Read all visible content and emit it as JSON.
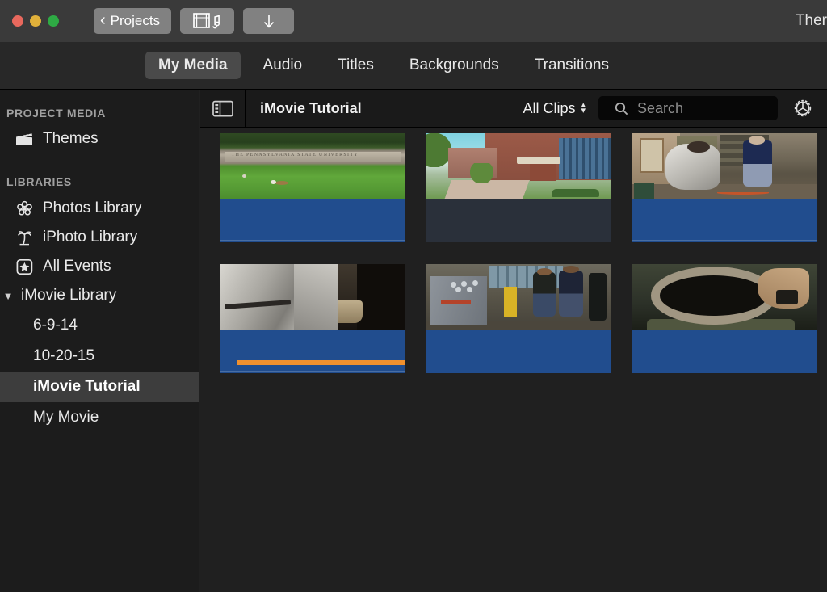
{
  "window": {
    "title": "Ther",
    "traffic_lights": [
      {
        "name": "close",
        "color": "#e8685d"
      },
      {
        "name": "minimize",
        "color": "#e0b03a"
      },
      {
        "name": "maximize",
        "color": "#2eaa44"
      }
    ]
  },
  "toolbar": {
    "projects_label": "Projects",
    "back_chevron": "‹",
    "media_music_icon": "film-music-icon",
    "download_icon": "download-arrow-icon",
    "download_glyph": "↓"
  },
  "tabs": [
    {
      "label": "My Media",
      "active": true
    },
    {
      "label": "Audio",
      "active": false
    },
    {
      "label": "Titles",
      "active": false
    },
    {
      "label": "Backgrounds",
      "active": false
    },
    {
      "label": "Transitions",
      "active": false
    }
  ],
  "sidebar": {
    "sections": [
      {
        "heading": "PROJECT MEDIA",
        "items": [
          {
            "label": "Themes",
            "icon": "clapperboard-icon",
            "selected": false
          }
        ]
      },
      {
        "heading": "LIBRARIES",
        "items": [
          {
            "label": "Photos Library",
            "icon": "photos-flower-icon",
            "selected": false
          },
          {
            "label": "iPhoto Library",
            "icon": "palm-tree-icon",
            "selected": false
          },
          {
            "label": "All Events",
            "icon": "star-square-icon",
            "selected": false
          }
        ]
      }
    ],
    "library_root": {
      "label": "iMovie Library",
      "disclosure": "▼",
      "expanded": true,
      "children": [
        {
          "label": "6-9-14",
          "selected": false
        },
        {
          "label": "10-20-15",
          "selected": false
        },
        {
          "label": "iMovie Tutorial",
          "selected": true
        },
        {
          "label": "My Movie",
          "selected": false
        }
      ]
    }
  },
  "browser": {
    "sidebar_toggle_icon": "sidebar-toggle-icon",
    "title": "iMovie Tutorial",
    "filter_label": "All Clips",
    "filter_chevrons": "⌃⌄",
    "search": {
      "placeholder": "Search",
      "value": "",
      "icon": "search-icon"
    },
    "settings_icon": "gear-icon",
    "clips": [
      {
        "name": "penn-state-sign",
        "footer": "blue",
        "favorite": false
      },
      {
        "name": "campus-building",
        "footer": "grey",
        "favorite": false
      },
      {
        "name": "foundry-pour",
        "footer": "blue",
        "favorite": false
      },
      {
        "name": "silver-suit-closeup",
        "footer": "blue",
        "favorite": true
      },
      {
        "name": "machine-shop-group",
        "footer": "blue",
        "favorite": false
      },
      {
        "name": "crucible-ring",
        "footer": "blue",
        "favorite": false
      }
    ],
    "thumb_art": {
      "penn_state_text": "THE PENNSYLVANIA STATE UNIVERSITY"
    }
  },
  "colors": {
    "titlebar_bg": "#3a3a3a",
    "tabbar_bg": "#282828",
    "sidebar_bg": "#1c1c1c",
    "browser_bg": "#202020",
    "selection": "#3d3d3d",
    "clip_blue": "#214d8e",
    "clip_grey": "#2a303a",
    "favorite_orange": "#f0902e",
    "search_bg": "#070707",
    "button_grey": "#818181"
  }
}
